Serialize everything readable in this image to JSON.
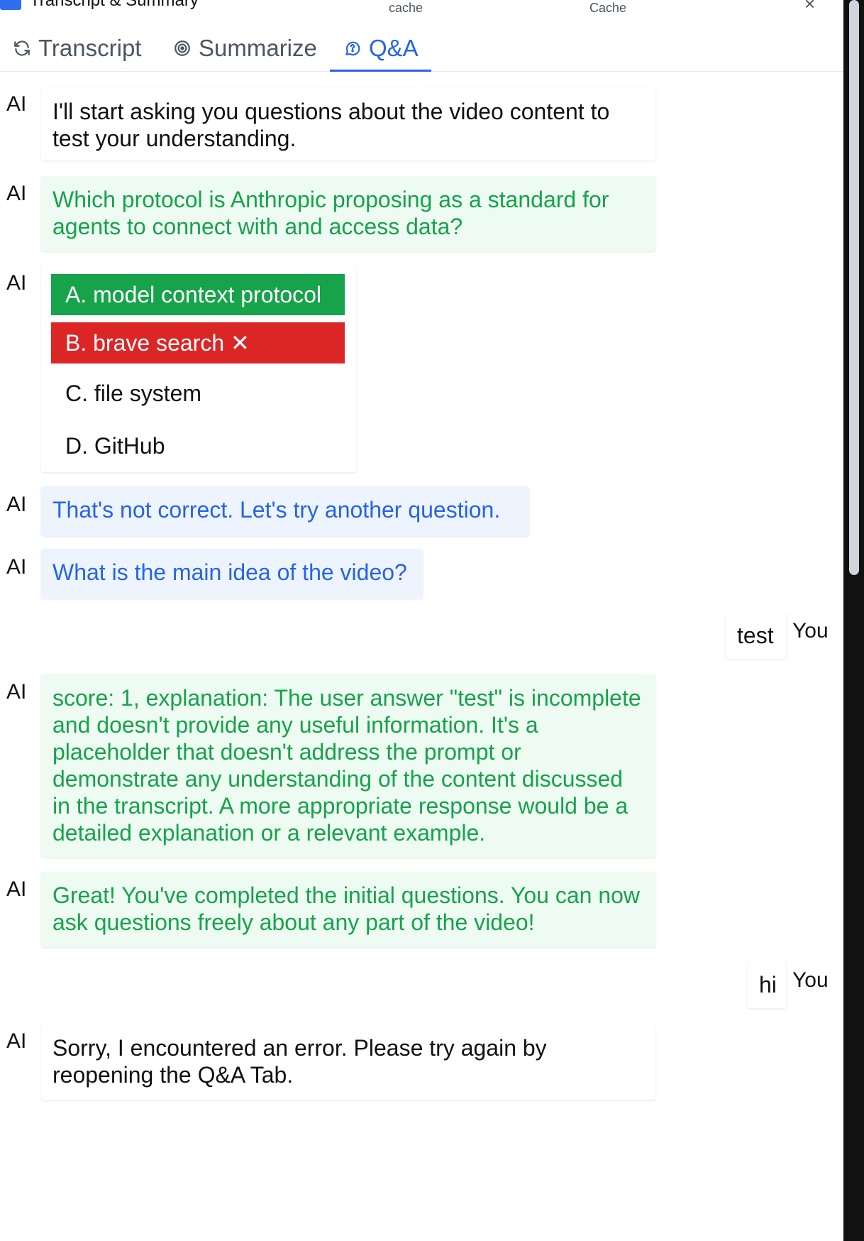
{
  "header": {
    "title": "Transcript & Summary",
    "cache_left": "cache",
    "cache_right": "Cache",
    "close": "×"
  },
  "tabs": [
    {
      "label": "Transcript",
      "icon": "refresh-icon"
    },
    {
      "label": "Summarize",
      "icon": "target-icon"
    },
    {
      "label": "Q&A",
      "icon": "chat-icon",
      "active": true
    }
  ],
  "messages": [
    {
      "who": "AI",
      "text": "I'll start asking you questions about the video content to test your understanding.",
      "style": "plain"
    },
    {
      "who": "AI",
      "text": "Which protocol is Anthropic proposing as a standard for agents to connect with and access data?",
      "style": "green"
    },
    {
      "who": "AI",
      "style": "options",
      "options": [
        {
          "label": "A. model context protocol",
          "state": "correct"
        },
        {
          "label": "B. brave search ✕",
          "state": "wrong"
        },
        {
          "label": "C. file system",
          "state": "neutral"
        },
        {
          "label": "D. GitHub",
          "state": "neutral"
        }
      ]
    },
    {
      "who": "AI",
      "text": "That's not correct. Let's try another question.",
      "style": "blue"
    },
    {
      "who": "AI",
      "text": "What is the main idea of the video?",
      "style": "blue"
    },
    {
      "who": "You",
      "text": "test",
      "style": "user"
    },
    {
      "who": "AI",
      "text": "score: 1, explanation: The user answer \"test\" is incomplete and doesn't provide any useful information. It's a placeholder that doesn't address the prompt or demonstrate any understanding of the content discussed in the transcript. A more appropriate response would be a detailed explanation or a relevant example.",
      "style": "green"
    },
    {
      "who": "AI",
      "text": "Great! You've completed the initial questions. You can now ask questions freely about any part of the video!",
      "style": "green"
    },
    {
      "who": "You",
      "text": "hi",
      "style": "user"
    },
    {
      "who": "AI",
      "text": "Sorry, I encountered an error. Please try again by reopening the Q&A Tab.",
      "style": "plain"
    }
  ],
  "colors": {
    "accent": "#2563eb",
    "success": "#16a34a",
    "error": "#dc2626"
  }
}
